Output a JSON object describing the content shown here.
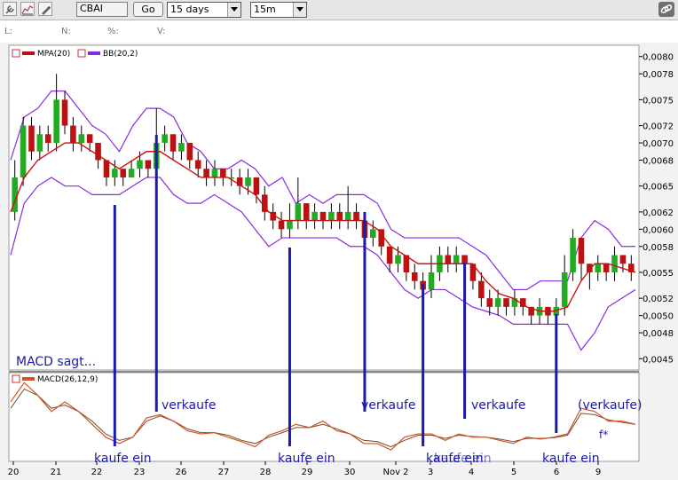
{
  "toolbar": {
    "symbol": "CBAI",
    "go_label": "Go",
    "range_label": "15 days",
    "interval_label": "15m"
  },
  "stats": {
    "last": "L:",
    "net": "N:",
    "pct": "%:",
    "volume": "V:"
  },
  "colors": {
    "up": "#22aa22",
    "down": "#bb1111",
    "mpa": "#cc1111",
    "bb": "#8a2be2",
    "macd": "#cc5522",
    "signal": "#7a4a2a",
    "annotation": "#1a1ab0"
  },
  "legend": {
    "mpa": "MPA(20)",
    "bb": "BB(20,2)",
    "macd": "MACD(26,12,9)"
  },
  "chart_data": {
    "type": "line",
    "subtype": "candlestick",
    "price_axis": {
      "ylim": [
        0.0044,
        0.0081
      ],
      "ticks": [
        "0,0080",
        "0,0078",
        "0,0075",
        "0,0072",
        "0,0070",
        "0,0068",
        "0,0065",
        "0,0062",
        "0,0060",
        "0,0058",
        "0,0055",
        "0,0052",
        "0,0050",
        "0,0048",
        "0,0045"
      ],
      "tick_values": [
        0.008,
        0.0078,
        0.0075,
        0.0072,
        0.007,
        0.0068,
        0.0065,
        0.0062,
        0.006,
        0.0058,
        0.0055,
        0.0052,
        0.005,
        0.0048,
        0.0045
      ]
    },
    "x_labels": [
      "20",
      "21",
      "22",
      "23",
      "26",
      "27",
      "28",
      "29",
      "30",
      "Nov 2",
      "3",
      "4",
      "5",
      "6",
      "9"
    ],
    "mpa_20": [
      [
        0,
        0.0062
      ],
      [
        2,
        0.0066
      ],
      [
        4,
        0.0068
      ],
      [
        6,
        0.0069
      ],
      [
        8,
        0.007
      ],
      [
        10,
        0.007
      ],
      [
        12,
        0.0069
      ],
      [
        14,
        0.0068
      ],
      [
        16,
        0.0067
      ],
      [
        18,
        0.0068
      ],
      [
        20,
        0.0069
      ],
      [
        22,
        0.0069
      ],
      [
        24,
        0.0068
      ],
      [
        26,
        0.0067
      ],
      [
        28,
        0.0066
      ],
      [
        30,
        0.0066
      ],
      [
        32,
        0.0066
      ],
      [
        34,
        0.0065
      ],
      [
        36,
        0.0064
      ],
      [
        38,
        0.0062
      ],
      [
        40,
        0.0061
      ],
      [
        42,
        0.0061
      ],
      [
        44,
        0.0061
      ],
      [
        46,
        0.0061
      ],
      [
        48,
        0.0061
      ],
      [
        50,
        0.0061
      ],
      [
        52,
        0.0061
      ],
      [
        54,
        0.006
      ],
      [
        56,
        0.0058
      ],
      [
        58,
        0.0057
      ],
      [
        60,
        0.0056
      ],
      [
        62,
        0.0056
      ],
      [
        64,
        0.0056
      ],
      [
        66,
        0.0056
      ],
      [
        68,
        0.0056
      ],
      [
        70,
        0.0054
      ],
      [
        72,
        0.00525
      ],
      [
        74,
        0.0052
      ],
      [
        76,
        0.0051
      ],
      [
        78,
        0.00505
      ],
      [
        80,
        0.00505
      ],
      [
        82,
        0.0051
      ],
      [
        84,
        0.0054
      ],
      [
        86,
        0.0056
      ],
      [
        88,
        0.0056
      ],
      [
        90,
        0.00555
      ],
      [
        92,
        0.0055
      ]
    ],
    "bb_upper": [
      [
        0,
        0.0068
      ],
      [
        2,
        0.0073
      ],
      [
        4,
        0.0074
      ],
      [
        6,
        0.0076
      ],
      [
        8,
        0.0076
      ],
      [
        10,
        0.0074
      ],
      [
        12,
        0.0072
      ],
      [
        14,
        0.0071
      ],
      [
        16,
        0.0069
      ],
      [
        18,
        0.0072
      ],
      [
        20,
        0.0074
      ],
      [
        22,
        0.0074
      ],
      [
        24,
        0.0073
      ],
      [
        26,
        0.007
      ],
      [
        28,
        0.0069
      ],
      [
        30,
        0.0067
      ],
      [
        32,
        0.0067
      ],
      [
        34,
        0.0068
      ],
      [
        36,
        0.0067
      ],
      [
        38,
        0.0065
      ],
      [
        40,
        0.0066
      ],
      [
        42,
        0.0063
      ],
      [
        44,
        0.0064
      ],
      [
        46,
        0.0063
      ],
      [
        48,
        0.0064
      ],
      [
        50,
        0.0064
      ],
      [
        52,
        0.0064
      ],
      [
        54,
        0.0063
      ],
      [
        56,
        0.006
      ],
      [
        58,
        0.0059
      ],
      [
        60,
        0.0059
      ],
      [
        62,
        0.0059
      ],
      [
        64,
        0.0059
      ],
      [
        66,
        0.0059
      ],
      [
        68,
        0.0058
      ],
      [
        70,
        0.0057
      ],
      [
        72,
        0.0055
      ],
      [
        74,
        0.0053
      ],
      [
        76,
        0.0053
      ],
      [
        78,
        0.0054
      ],
      [
        80,
        0.0054
      ],
      [
        82,
        0.0054
      ],
      [
        84,
        0.0059
      ],
      [
        86,
        0.0061
      ],
      [
        88,
        0.006
      ],
      [
        90,
        0.0058
      ],
      [
        92,
        0.0058
      ]
    ],
    "bb_lower": [
      [
        0,
        0.0057
      ],
      [
        2,
        0.0063
      ],
      [
        4,
        0.0065
      ],
      [
        6,
        0.0066
      ],
      [
        8,
        0.0065
      ],
      [
        10,
        0.0065
      ],
      [
        12,
        0.0064
      ],
      [
        14,
        0.0064
      ],
      [
        16,
        0.0064
      ],
      [
        18,
        0.0065
      ],
      [
        20,
        0.0066
      ],
      [
        22,
        0.0066
      ],
      [
        24,
        0.0064
      ],
      [
        26,
        0.0063
      ],
      [
        28,
        0.0063
      ],
      [
        30,
        0.0064
      ],
      [
        32,
        0.0063
      ],
      [
        34,
        0.0062
      ],
      [
        36,
        0.006
      ],
      [
        38,
        0.0058
      ],
      [
        40,
        0.0059
      ],
      [
        42,
        0.0059
      ],
      [
        44,
        0.0059
      ],
      [
        46,
        0.0059
      ],
      [
        48,
        0.0059
      ],
      [
        50,
        0.0058
      ],
      [
        52,
        0.0058
      ],
      [
        54,
        0.0057
      ],
      [
        56,
        0.0055
      ],
      [
        58,
        0.0053
      ],
      [
        60,
        0.0052
      ],
      [
        62,
        0.0053
      ],
      [
        64,
        0.0053
      ],
      [
        66,
        0.0052
      ],
      [
        68,
        0.0051
      ],
      [
        70,
        0.00505
      ],
      [
        72,
        0.005
      ],
      [
        74,
        0.0049
      ],
      [
        76,
        0.0049
      ],
      [
        78,
        0.0049
      ],
      [
        80,
        0.0049
      ],
      [
        82,
        0.0049
      ],
      [
        84,
        0.0046
      ],
      [
        86,
        0.0048
      ],
      [
        88,
        0.0051
      ],
      [
        90,
        0.0052
      ],
      [
        92,
        0.0053
      ]
    ],
    "macd_line": [
      [
        0,
        0.6
      ],
      [
        2,
        0.9
      ],
      [
        4,
        0.7
      ],
      [
        6,
        0.45
      ],
      [
        8,
        0.6
      ],
      [
        10,
        0.45
      ],
      [
        12,
        0.25
      ],
      [
        14,
        0.05
      ],
      [
        16,
        -0.05
      ],
      [
        18,
        0.05
      ],
      [
        20,
        0.35
      ],
      [
        22,
        0.4
      ],
      [
        24,
        0.3
      ],
      [
        26,
        0.15
      ],
      [
        28,
        0.1
      ],
      [
        30,
        0.12
      ],
      [
        32,
        0.05
      ],
      [
        34,
        -0.02
      ],
      [
        36,
        -0.1
      ],
      [
        38,
        0.08
      ],
      [
        40,
        0.15
      ],
      [
        42,
        0.25
      ],
      [
        44,
        0.2
      ],
      [
        46,
        0.3
      ],
      [
        48,
        0.15
      ],
      [
        50,
        0.1
      ],
      [
        52,
        -0.05
      ],
      [
        54,
        -0.05
      ],
      [
        56,
        -0.15
      ],
      [
        58,
        0.05
      ],
      [
        60,
        0.1
      ],
      [
        62,
        0.1
      ],
      [
        64,
        0.0
      ],
      [
        66,
        0.1
      ],
      [
        68,
        0.05
      ],
      [
        70,
        0.05
      ],
      [
        72,
        0.0
      ],
      [
        74,
        -0.05
      ],
      [
        76,
        0.05
      ],
      [
        78,
        0.02
      ],
      [
        80,
        0.05
      ],
      [
        82,
        0.1
      ],
      [
        84,
        0.5
      ],
      [
        86,
        0.45
      ],
      [
        88,
        0.3
      ],
      [
        90,
        0.3
      ],
      [
        92,
        0.25
      ]
    ],
    "signal_line": [
      [
        0,
        0.5
      ],
      [
        2,
        0.8
      ],
      [
        4,
        0.7
      ],
      [
        6,
        0.5
      ],
      [
        8,
        0.55
      ],
      [
        10,
        0.45
      ],
      [
        12,
        0.3
      ],
      [
        14,
        0.1
      ],
      [
        16,
        0.0
      ],
      [
        18,
        0.05
      ],
      [
        20,
        0.3
      ],
      [
        22,
        0.38
      ],
      [
        24,
        0.3
      ],
      [
        26,
        0.18
      ],
      [
        28,
        0.12
      ],
      [
        30,
        0.12
      ],
      [
        32,
        0.08
      ],
      [
        34,
        0.0
      ],
      [
        36,
        -0.05
      ],
      [
        38,
        0.05
      ],
      [
        40,
        0.12
      ],
      [
        42,
        0.2
      ],
      [
        44,
        0.2
      ],
      [
        46,
        0.25
      ],
      [
        48,
        0.18
      ],
      [
        50,
        0.1
      ],
      [
        52,
        0.0
      ],
      [
        54,
        -0.02
      ],
      [
        56,
        -0.1
      ],
      [
        58,
        0.0
      ],
      [
        60,
        0.08
      ],
      [
        62,
        0.08
      ],
      [
        64,
        0.03
      ],
      [
        66,
        0.08
      ],
      [
        68,
        0.06
      ],
      [
        70,
        0.05
      ],
      [
        72,
        0.02
      ],
      [
        74,
        -0.02
      ],
      [
        76,
        0.03
      ],
      [
        78,
        0.03
      ],
      [
        80,
        0.04
      ],
      [
        82,
        0.08
      ],
      [
        84,
        0.42
      ],
      [
        86,
        0.4
      ],
      [
        88,
        0.32
      ],
      [
        90,
        0.28
      ],
      [
        92,
        0.25
      ]
    ],
    "candles": [
      [
        0,
        0.0062,
        0.0066,
        0.0068,
        0.0061
      ],
      [
        1,
        0.0066,
        0.0072,
        0.0073,
        0.0065
      ],
      [
        2,
        0.0072,
        0.0069,
        0.0073,
        0.0068
      ],
      [
        3,
        0.0069,
        0.0071,
        0.0072,
        0.0068
      ],
      [
        4,
        0.0071,
        0.007,
        0.0072,
        0.0069
      ],
      [
        5,
        0.007,
        0.0075,
        0.0078,
        0.0069
      ],
      [
        6,
        0.0075,
        0.0072,
        0.0076,
        0.0071
      ],
      [
        7,
        0.0072,
        0.007,
        0.0073,
        0.0069
      ],
      [
        8,
        0.007,
        0.0071,
        0.0072,
        0.0069
      ],
      [
        9,
        0.0071,
        0.007,
        0.0071,
        0.0069
      ],
      [
        10,
        0.007,
        0.0068,
        0.007,
        0.0067
      ],
      [
        11,
        0.0068,
        0.0066,
        0.0068,
        0.0065
      ],
      [
        12,
        0.0066,
        0.0067,
        0.0068,
        0.0065
      ],
      [
        13,
        0.0067,
        0.0066,
        0.0067,
        0.0065
      ],
      [
        14,
        0.0066,
        0.0067,
        0.0068,
        0.0066
      ],
      [
        15,
        0.0067,
        0.0068,
        0.0069,
        0.0066
      ],
      [
        16,
        0.0068,
        0.0067,
        0.0068,
        0.0066
      ],
      [
        17,
        0.0067,
        0.007,
        0.0074,
        0.0066
      ],
      [
        18,
        0.007,
        0.0071,
        0.0072,
        0.0069
      ],
      [
        19,
        0.0071,
        0.0069,
        0.0071,
        0.0068
      ],
      [
        20,
        0.0069,
        0.007,
        0.0071,
        0.0068
      ],
      [
        21,
        0.007,
        0.0068,
        0.007,
        0.0067
      ],
      [
        22,
        0.0068,
        0.0067,
        0.0069,
        0.0066
      ],
      [
        23,
        0.0067,
        0.0066,
        0.0068,
        0.0065
      ],
      [
        24,
        0.0066,
        0.0067,
        0.0068,
        0.0065
      ],
      [
        25,
        0.0067,
        0.0066,
        0.0067,
        0.0065
      ],
      [
        26,
        0.0066,
        0.0066,
        0.0067,
        0.0065
      ],
      [
        27,
        0.0066,
        0.0065,
        0.0067,
        0.0064
      ],
      [
        28,
        0.0065,
        0.0066,
        0.0067,
        0.0064
      ],
      [
        29,
        0.0066,
        0.0064,
        0.0066,
        0.0063
      ],
      [
        30,
        0.0064,
        0.0062,
        0.0065,
        0.0061
      ],
      [
        31,
        0.0062,
        0.0061,
        0.0063,
        0.006
      ],
      [
        32,
        0.0061,
        0.006,
        0.0062,
        0.0059
      ],
      [
        33,
        0.006,
        0.0061,
        0.0063,
        0.0059
      ],
      [
        34,
        0.0061,
        0.0063,
        0.0066,
        0.006
      ],
      [
        35,
        0.0063,
        0.0061,
        0.0063,
        0.006
      ],
      [
        36,
        0.0061,
        0.0062,
        0.0063,
        0.006
      ],
      [
        37,
        0.0062,
        0.0061,
        0.0062,
        0.006
      ],
      [
        38,
        0.0061,
        0.0062,
        0.0063,
        0.006
      ],
      [
        39,
        0.0062,
        0.0061,
        0.0063,
        0.006
      ],
      [
        40,
        0.0061,
        0.0062,
        0.0065,
        0.006
      ],
      [
        41,
        0.0062,
        0.0061,
        0.0063,
        0.006
      ],
      [
        42,
        0.0061,
        0.0059,
        0.0062,
        0.0058
      ],
      [
        43,
        0.0059,
        0.006,
        0.0061,
        0.0058
      ],
      [
        44,
        0.006,
        0.0058,
        0.006,
        0.0057
      ],
      [
        45,
        0.0058,
        0.0056,
        0.0058,
        0.0055
      ],
      [
        46,
        0.0056,
        0.0057,
        0.0058,
        0.0055
      ],
      [
        47,
        0.0057,
        0.0055,
        0.0057,
        0.0054
      ],
      [
        48,
        0.0055,
        0.0054,
        0.0056,
        0.0053
      ],
      [
        49,
        0.0054,
        0.0053,
        0.0055,
        0.0052
      ],
      [
        50,
        0.0053,
        0.0055,
        0.0057,
        0.0052
      ],
      [
        51,
        0.0055,
        0.0057,
        0.0058,
        0.0054
      ],
      [
        52,
        0.0057,
        0.0056,
        0.0058,
        0.0055
      ],
      [
        53,
        0.0056,
        0.0057,
        0.0058,
        0.0055
      ],
      [
        54,
        0.0057,
        0.0056,
        0.0057,
        0.0055
      ],
      [
        55,
        0.0056,
        0.0054,
        0.0056,
        0.0053
      ],
      [
        56,
        0.0054,
        0.0052,
        0.0055,
        0.0051
      ],
      [
        57,
        0.0052,
        0.0051,
        0.0053,
        0.005
      ],
      [
        58,
        0.0051,
        0.0052,
        0.0053,
        0.005
      ],
      [
        59,
        0.0052,
        0.0051,
        0.0052,
        0.005
      ],
      [
        60,
        0.0051,
        0.0052,
        0.0053,
        0.005
      ],
      [
        61,
        0.0052,
        0.0051,
        0.0052,
        0.005
      ],
      [
        62,
        0.0051,
        0.005,
        0.0051,
        0.0049
      ],
      [
        63,
        0.005,
        0.0051,
        0.0052,
        0.0049
      ],
      [
        64,
        0.0051,
        0.005,
        0.0051,
        0.0049
      ],
      [
        65,
        0.005,
        0.0051,
        0.0052,
        0.0049
      ],
      [
        66,
        0.0051,
        0.0055,
        0.0057,
        0.005
      ],
      [
        67,
        0.0055,
        0.0059,
        0.006,
        0.0054
      ],
      [
        68,
        0.0059,
        0.0056,
        0.0059,
        0.0054
      ],
      [
        69,
        0.0056,
        0.0055,
        0.0056,
        0.0053
      ],
      [
        70,
        0.0055,
        0.0056,
        0.0057,
        0.0054
      ],
      [
        71,
        0.0056,
        0.0055,
        0.0056,
        0.0054
      ],
      [
        72,
        0.0055,
        0.0057,
        0.0058,
        0.0054
      ],
      [
        73,
        0.0057,
        0.0056,
        0.0057,
        0.0055
      ],
      [
        74,
        0.0056,
        0.0055,
        0.0057,
        0.0054
      ]
    ],
    "candle_count": 75,
    "vertical_markers": [
      {
        "x": 12,
        "top": 0.0066,
        "bottom_label": "kaufe ein"
      },
      {
        "x": 17,
        "top": 0.007,
        "bottom_label": "verkaufe"
      },
      {
        "x": 33,
        "top": 0.0058,
        "bottom_label": "kaufe ein"
      },
      {
        "x": 42,
        "top": 0.0061,
        "bottom_label": "verkaufe"
      },
      {
        "x": 49,
        "top": 0.0053,
        "bottom_label": "kaufe ein"
      },
      {
        "x": 54,
        "top": 0.0056,
        "bottom_label": "verkaufe"
      },
      {
        "x": 65,
        "top": 0.005,
        "bottom_label": "kaufe ein"
      }
    ],
    "annotations": [
      "MACD sagt...",
      "verkaufe",
      "verkaufe",
      "verkaufe",
      "(verkaufe)",
      "kaufe ein",
      "kaufe ein",
      "kaufe ein",
      "kaufe ein",
      "kaufe ein",
      "f*"
    ]
  }
}
